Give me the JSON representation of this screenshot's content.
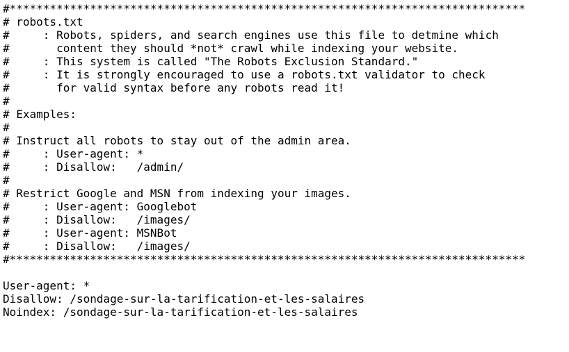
{
  "document": {
    "lines": [
      "#*****************************************************************************",
      "# robots.txt",
      "#     : Robots, spiders, and search engines use this file to detmine which",
      "#       content they should *not* crawl while indexing your website.",
      "#     : This system is called \"The Robots Exclusion Standard.\"",
      "#     : It is strongly encouraged to use a robots.txt validator to check",
      "#       for valid syntax before any robots read it!",
      "#",
      "# Examples:",
      "#",
      "# Instruct all robots to stay out of the admin area.",
      "#     : User-agent: *",
      "#     : Disallow:   /admin/",
      "#",
      "# Restrict Google and MSN from indexing your images.",
      "#     : User-agent: Googlebot",
      "#     : Disallow:   /images/",
      "#     : User-agent: MSNBot",
      "#     : Disallow:   /images/",
      "#*****************************************************************************",
      "",
      "User-agent: *",
      "Disallow: /sondage-sur-la-tarification-et-les-salaires",
      "Noindex: /sondage-sur-la-tarification-et-les-salaires"
    ]
  }
}
